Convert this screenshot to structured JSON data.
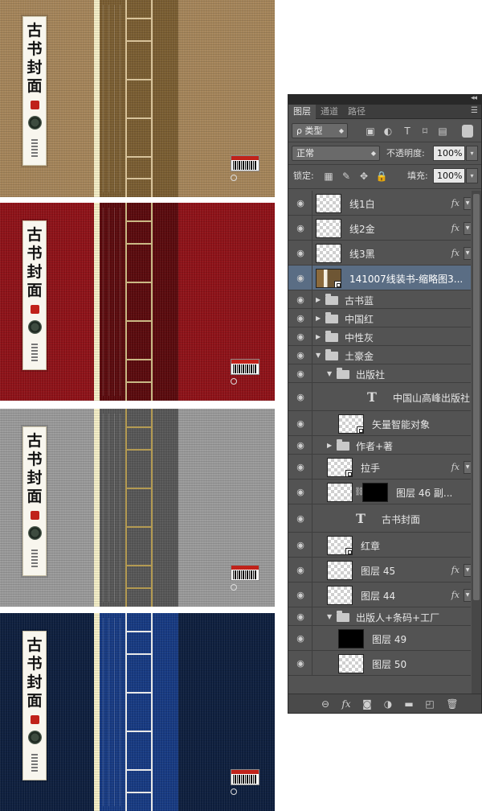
{
  "covers": [
    {
      "name": "gold",
      "colors": {
        "board": "#a5855a",
        "boardDark": "#8c7048",
        "strip": "#f3edc6",
        "spine": "#7a5e32",
        "spineLight": "#9a7a48",
        "binding": "#d8c39a"
      },
      "label": {
        "title": "古书封面"
      }
    },
    {
      "name": "red",
      "colors": {
        "board": "#8e1218",
        "boardDark": "#6e0c10",
        "strip": "#f3edc6",
        "spine": "#5a0a0d",
        "spineLight": "#7a0e12",
        "binding": "#c9b884"
      },
      "label": {
        "title": "古书封面"
      }
    },
    {
      "name": "gray",
      "colors": {
        "board": "#9a9a9a",
        "boardDark": "#7b7b7b",
        "strip": "#f3edc6",
        "spine": "#575757",
        "spineLight": "#6c6c6c",
        "binding": "#b39a52"
      },
      "label": {
        "title": "古书封面"
      }
    },
    {
      "name": "blue",
      "colors": {
        "board": "#0e1f3e",
        "boardDark": "#0a162d",
        "strip": "#f3edc6",
        "spine": "#173a82",
        "spineLight": "#2150a8",
        "binding": "#e8e8e8"
      },
      "label": {
        "title": "古书封面"
      }
    }
  ],
  "panel": {
    "tabs": [
      "图层",
      "通道",
      "路径"
    ],
    "activeTab": 0,
    "filter": {
      "label": "ρ 类型",
      "icons": [
        "image-filter-icon",
        "adjustment-filter-icon",
        "type-filter-icon",
        "shape-filter-icon",
        "smartobject-filter-icon"
      ]
    },
    "blend": {
      "mode": "正常",
      "opacity_label": "不透明度:",
      "opacity": "100%"
    },
    "lock": {
      "label": "锁定:",
      "fill_label": "填充:",
      "fill": "100%"
    },
    "layers": [
      {
        "name": "线1白",
        "kind": "normal",
        "indent": 0,
        "fx": true
      },
      {
        "name": "线2金",
        "kind": "normal",
        "indent": 0,
        "fx": true
      },
      {
        "name": "线3黑",
        "kind": "normal",
        "indent": 0,
        "fx": true
      },
      {
        "name": "141007线装书-缩略图3...",
        "kind": "photo",
        "indent": 0,
        "fx": false,
        "selected": true
      },
      {
        "name": "古书蓝",
        "kind": "group",
        "indent": 0,
        "open": false
      },
      {
        "name": "中国红",
        "kind": "group",
        "indent": 0,
        "open": false
      },
      {
        "name": "中性灰",
        "kind": "group",
        "indent": 0,
        "open": false
      },
      {
        "name": "土豪金",
        "kind": "group",
        "indent": 0,
        "open": true
      },
      {
        "name": "出版社",
        "kind": "group",
        "indent": 1,
        "open": true
      },
      {
        "name": "中国山高峰出版社",
        "kind": "text",
        "indent": 2
      },
      {
        "name": "矢量智能对象",
        "kind": "smart",
        "indent": 2
      },
      {
        "name": "作者+著",
        "kind": "group",
        "indent": 1,
        "open": false
      },
      {
        "name": "拉手",
        "kind": "smart",
        "indent": 1,
        "fx": true
      },
      {
        "name": "图层 46 副...",
        "kind": "masked",
        "indent": 1
      },
      {
        "name": "古书封面",
        "kind": "text",
        "indent": 1
      },
      {
        "name": "红章",
        "kind": "smart",
        "indent": 1
      },
      {
        "name": "图层 45",
        "kind": "normal",
        "indent": 1,
        "fx": true
      },
      {
        "name": "图层 44",
        "kind": "normal",
        "indent": 1,
        "fx": true
      },
      {
        "name": "出版人+条码+工厂",
        "kind": "group",
        "indent": 1,
        "open": true
      },
      {
        "name": "图层 49",
        "kind": "black",
        "indent": 2
      },
      {
        "name": "图层 50",
        "kind": "normal",
        "indent": 2
      }
    ],
    "footer_icons": [
      "link-layers-icon",
      "fx-icon",
      "mask-icon",
      "adjustment-icon",
      "new-group-icon",
      "new-layer-icon",
      "trash-icon"
    ]
  }
}
